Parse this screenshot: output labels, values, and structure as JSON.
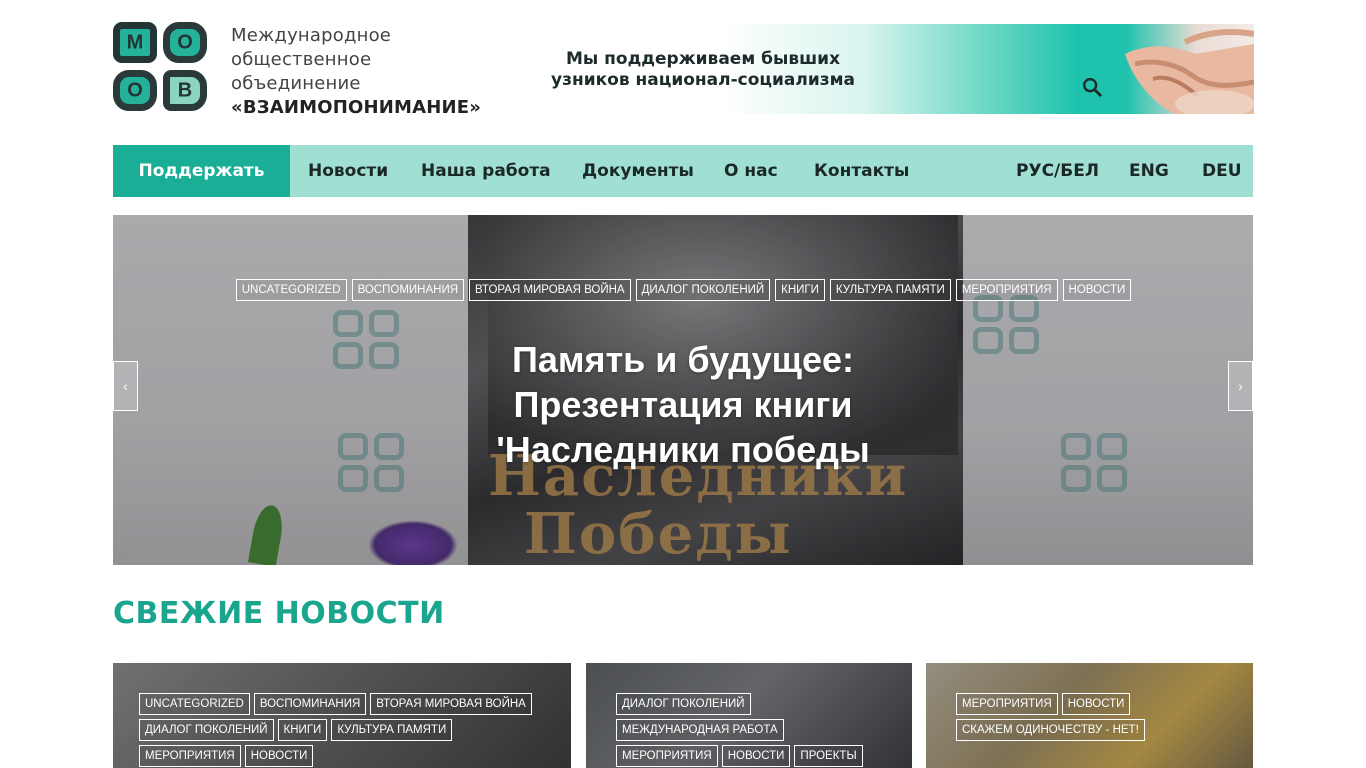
{
  "header": {
    "logo_letters": [
      "M",
      "O",
      "O",
      "B"
    ],
    "org_line1": "Международное",
    "org_line2": "общественное",
    "org_line3": "объединение",
    "org_line4": "«ВЗАИМОПОНИМАНИЕ»",
    "banner_line1": "Мы поддерживаем бывших",
    "banner_line2": "узников национал-социализма",
    "search_icon": "search-icon"
  },
  "nav": {
    "support": "Поддержать",
    "items": [
      "Новости",
      "Наша работа",
      "Документы",
      "О нас",
      "Контакты"
    ],
    "languages": [
      "РУС/БЕЛ",
      "ENG",
      "DEU"
    ]
  },
  "slider": {
    "tags": [
      "Uncategorized",
      "Воспоминания",
      "Вторая мировая война",
      "Диалог поколений",
      "Книги",
      "Культура памяти",
      "Мероприятия",
      "Новости"
    ],
    "title_line1": "Память и будущее:",
    "title_line2": "Презентация книги",
    "title_line3": "'Наследники победы",
    "prev_label": "‹",
    "next_label": "›",
    "book_cover_line1": "Наследники",
    "book_cover_line2": "Победы"
  },
  "fresh_news": {
    "title": "СВЕЖИЕ НОВОСТИ",
    "cards": [
      {
        "tags": [
          "Uncategorized",
          "Воспоминания",
          "Вторая мировая война",
          "Диалог поколений",
          "Книги",
          "Культура памяти",
          "Мероприятия",
          "Новости"
        ]
      },
      {
        "tags": [
          "Диалог поколений",
          "Международная работа",
          "Мероприятия",
          "Новости",
          "Проекты"
        ]
      },
      {
        "tags": [
          "Мероприятия",
          "Новости",
          "Скажем одиночеству - нет!"
        ]
      }
    ]
  },
  "colors": {
    "accent": "#1aae97",
    "nav_bg": "#9fe0d2",
    "section_title": "#1aa58f"
  }
}
